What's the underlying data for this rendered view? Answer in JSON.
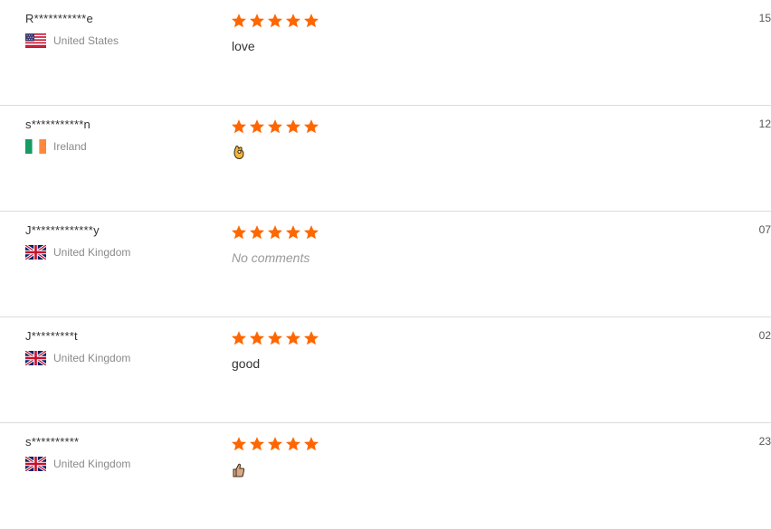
{
  "colors": {
    "star": "#ff6600",
    "divider": "#dcdcdc",
    "muted": "#8a8a8a"
  },
  "reviews": [
    {
      "name": "R***********e",
      "country": "United States",
      "flag_icon": "us-flag-icon",
      "rating_stars": 5,
      "comment": "love",
      "date": "15"
    },
    {
      "name": "s***********n",
      "country": "Ireland",
      "flag_icon": "ireland-flag-icon",
      "rating_stars": 5,
      "comment_icon": "ok-hand-emoji-icon",
      "date": "12"
    },
    {
      "name": "J*************y",
      "country": "United Kingdom",
      "flag_icon": "uk-flag-icon",
      "rating_stars": 5,
      "comment": "No comments",
      "date": "07"
    },
    {
      "name": "J*********t",
      "country": "United Kingdom",
      "flag_icon": "uk-flag-icon",
      "rating_stars": 5,
      "comment": "good",
      "date": "02"
    },
    {
      "name": "s**********",
      "country": "United Kingdom",
      "flag_icon": "uk-flag-icon",
      "rating_stars": 5,
      "comment_icon": "thumbs-up-emoji-icon",
      "date": "23"
    }
  ]
}
